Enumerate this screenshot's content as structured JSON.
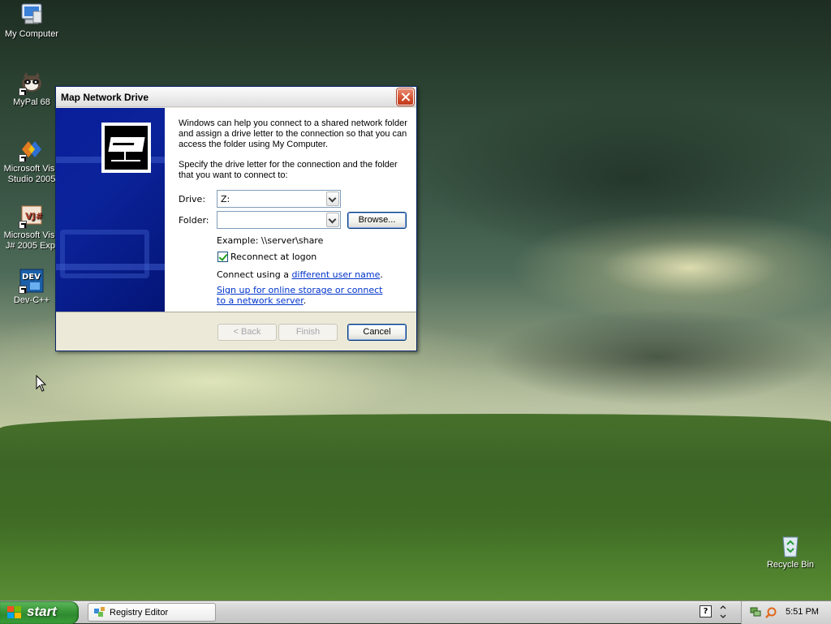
{
  "desktop": {
    "icons": [
      {
        "label": "My Computer"
      },
      {
        "label": "MyPal 68"
      },
      {
        "label": "Microsoft Visu\nStudio 2005",
        "line1": "Microsoft Visu",
        "line2": "Studio 2005"
      },
      {
        "label": "Microsoft Visu\nJ# 2005 Exp.",
        "line1": "Microsoft Visu",
        "line2": "J# 2005 Exp."
      },
      {
        "label": "Dev-C++"
      },
      {
        "label": "Recycle Bin"
      }
    ]
  },
  "dialog": {
    "title": "Map Network Drive",
    "intro": "Windows can help you connect to a shared network folder and assign a drive letter to the connection so that you can access the folder using My Computer.",
    "instruction": "Specify the drive letter for the connection and the folder that you want to connect to:",
    "drive": {
      "label": "Drive:",
      "value": "Z:"
    },
    "folder": {
      "label": "Folder:",
      "value": ""
    },
    "browse_label": "Browse...",
    "example": "Example: \\\\server\\share",
    "reconnect": {
      "label": "Reconnect at logon",
      "checked": true
    },
    "connect_using_prefix": "Connect using a ",
    "connect_using_link": "different user name",
    "connect_using_suffix": ".",
    "signup_link": "Sign up for online storage or connect to a network server",
    "signup_suffix": ".",
    "buttons": {
      "back": "< Back",
      "finish": "Finish",
      "cancel": "Cancel"
    }
  },
  "taskbar": {
    "start_label": "start",
    "tasks": [
      {
        "label": "Registry Editor"
      }
    ],
    "clock": "5:51 PM"
  },
  "colors": {
    "dialog_sidebar": "#0b239a",
    "link": "#0033cc",
    "start_green": "#3c9a3a"
  }
}
